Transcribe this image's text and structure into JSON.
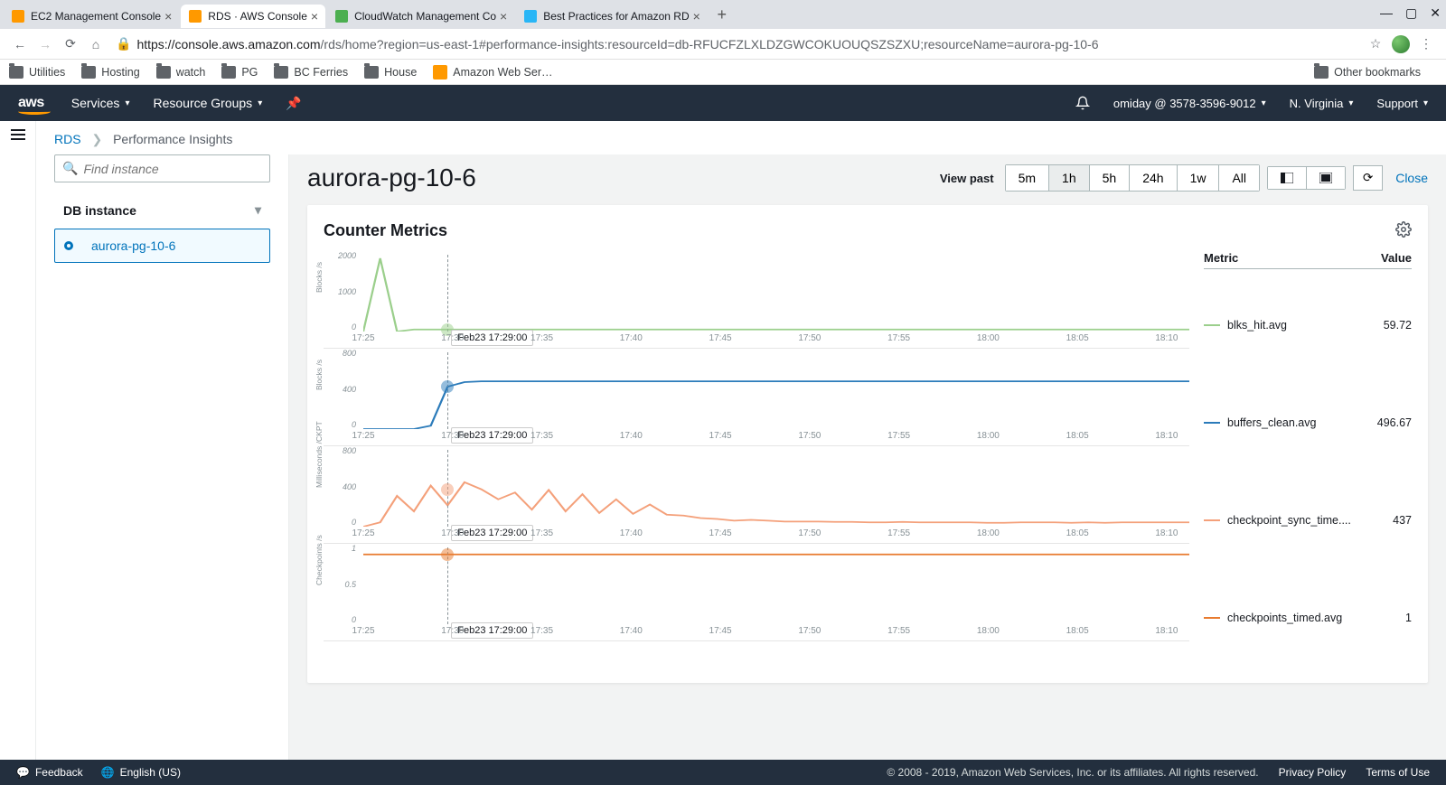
{
  "browser": {
    "tabs": [
      {
        "title": "EC2 Management Console",
        "color": "#ff9900"
      },
      {
        "title": "RDS · AWS Console",
        "color": "#ff9900"
      },
      {
        "title": "CloudWatch Management Co",
        "color": "#4caf50"
      },
      {
        "title": "Best Practices for Amazon RD",
        "color": "#29b6f6"
      }
    ],
    "url_domain": "https://console.aws.amazon.com",
    "url_path": "/rds/home?region=us-east-1#performance-insights:resourceId=db-RFUCFZLXLDZGWCOKUOUQSZSZXU;resourceName=aurora-pg-10-6"
  },
  "bookmarks": {
    "items": [
      "Utilities",
      "Hosting",
      "watch",
      "PG",
      "BC Ferries",
      "House"
    ],
    "aws_label": "Amazon Web Ser…",
    "other": "Other bookmarks"
  },
  "header": {
    "logo": "aws",
    "services": "Services",
    "resource_groups": "Resource Groups",
    "account": "omiday @ 3578-3596-9012",
    "region": "N. Virginia",
    "support": "Support"
  },
  "breadcrumb": {
    "root": "RDS",
    "current": "Performance Insights"
  },
  "sidebar": {
    "search_placeholder": "Find instance",
    "db_header": "DB instance",
    "instance": "aurora-pg-10-6"
  },
  "page": {
    "title": "aurora-pg-10-6",
    "view_past": "View past",
    "ranges": [
      "5m",
      "1h",
      "5h",
      "24h",
      "1w",
      "All"
    ],
    "active_range": "1h",
    "close": "Close"
  },
  "card": {
    "title": "Counter Metrics",
    "metric_h": "Metric",
    "value_h": "Value"
  },
  "cursor_label": "Feb23 17:29:00",
  "xticks": [
    "17:25",
    "17:30",
    "17:35",
    "17:40",
    "17:45",
    "17:50",
    "17:55",
    "18:00",
    "18:05",
    "18:10"
  ],
  "legend": [
    {
      "name": "blks_hit.avg",
      "value": "59.72",
      "color": "#9bcf8c"
    },
    {
      "name": "buffers_clean.avg",
      "value": "496.67",
      "color": "#2b7bba"
    },
    {
      "name": "checkpoint_sync_time....",
      "value": "437",
      "color": "#f4a07a"
    },
    {
      "name": "checkpoints_timed.avg",
      "value": "1",
      "color": "#e87b2f"
    }
  ],
  "chart_data": [
    {
      "type": "line",
      "name": "blks_hit.avg",
      "ylabel": "Blocks /s",
      "yticks": [
        "2000",
        "1000",
        "0"
      ],
      "ylim": [
        0,
        2200
      ],
      "color": "#9bcf8c",
      "cursor_y": 60,
      "x": [
        0,
        1,
        2,
        3,
        4,
        5,
        6,
        7,
        8,
        9,
        10,
        11,
        12,
        13,
        14,
        15,
        16,
        17,
        18,
        19,
        20,
        21,
        22,
        23,
        24,
        25,
        26,
        27,
        28,
        29,
        30,
        31,
        32,
        33,
        34,
        35,
        36,
        37,
        38,
        39,
        40,
        41,
        42,
        43,
        44,
        45,
        46,
        47,
        48,
        49
      ],
      "y": [
        0,
        2100,
        0,
        60,
        60,
        60,
        60,
        60,
        60,
        60,
        60,
        60,
        60,
        60,
        60,
        60,
        60,
        60,
        60,
        60,
        60,
        60,
        60,
        60,
        60,
        60,
        60,
        60,
        60,
        60,
        60,
        60,
        60,
        60,
        60,
        60,
        60,
        60,
        60,
        60,
        60,
        60,
        60,
        60,
        60,
        60,
        60,
        60,
        60,
        60
      ]
    },
    {
      "type": "line",
      "name": "buffers_clean.avg",
      "ylabel": "Blocks /s",
      "yticks": [
        "800",
        "400",
        "0"
      ],
      "ylim": [
        0,
        900
      ],
      "color": "#2b7bba",
      "cursor_y": 497,
      "x": [
        0,
        1,
        2,
        3,
        4,
        5,
        6,
        7,
        8,
        9,
        10,
        11,
        12,
        13,
        14,
        15,
        16,
        17,
        18,
        19,
        20,
        21,
        22,
        23,
        24,
        25,
        26,
        27,
        28,
        29,
        30,
        31,
        32,
        33,
        34,
        35,
        36,
        37,
        38,
        39,
        40,
        41,
        42,
        43,
        44,
        45,
        46,
        47,
        48,
        49
      ],
      "y": [
        0,
        0,
        0,
        0,
        40,
        497,
        550,
        560,
        560,
        560,
        560,
        560,
        560,
        560,
        560,
        560,
        560,
        560,
        560,
        560,
        560,
        560,
        560,
        560,
        560,
        560,
        560,
        560,
        560,
        560,
        560,
        560,
        560,
        560,
        560,
        560,
        560,
        560,
        560,
        560,
        560,
        560,
        560,
        560,
        560,
        560,
        560,
        560,
        560,
        560
      ]
    },
    {
      "type": "line",
      "name": "checkpoint_sync_time",
      "ylabel": "Milliseconds /CKPT",
      "yticks": [
        "800",
        "400",
        "0"
      ],
      "ylim": [
        0,
        900
      ],
      "color": "#f4a07a",
      "cursor_y": 437,
      "x": [
        0,
        1,
        2,
        3,
        4,
        5,
        6,
        7,
        8,
        9,
        10,
        11,
        12,
        13,
        14,
        15,
        16,
        17,
        18,
        19,
        20,
        21,
        22,
        23,
        24,
        25,
        26,
        27,
        28,
        29,
        30,
        31,
        32,
        33,
        34,
        35,
        36,
        37,
        38,
        39,
        40,
        41,
        42,
        43,
        44,
        45,
        46,
        47,
        48,
        49
      ],
      "y": [
        0,
        50,
        360,
        180,
        480,
        250,
        520,
        437,
        320,
        400,
        200,
        430,
        180,
        380,
        160,
        320,
        150,
        260,
        140,
        130,
        100,
        90,
        70,
        80,
        70,
        60,
        60,
        60,
        55,
        55,
        50,
        50,
        55,
        50,
        50,
        50,
        50,
        45,
        45,
        50,
        50,
        50,
        45,
        50,
        45,
        50,
        50,
        50,
        50,
        50
      ]
    },
    {
      "type": "line",
      "name": "checkpoints_timed.avg",
      "ylabel": "Checkpoints /s",
      "yticks": [
        "1",
        "0.5",
        "0"
      ],
      "ylim": [
        0,
        1.1
      ],
      "color": "#e87b2f",
      "cursor_y": 1,
      "x": [
        0,
        1,
        2,
        3,
        4,
        5,
        6,
        7,
        8,
        9,
        10,
        11,
        12,
        13,
        14,
        15,
        16,
        17,
        18,
        19,
        20,
        21,
        22,
        23,
        24,
        25,
        26,
        27,
        28,
        29,
        30,
        31,
        32,
        33,
        34,
        35,
        36,
        37,
        38,
        39,
        40,
        41,
        42,
        43,
        44,
        45,
        46,
        47,
        48,
        49
      ],
      "y": [
        1,
        1,
        1,
        1,
        1,
        1,
        1,
        1,
        1,
        1,
        1,
        1,
        1,
        1,
        1,
        1,
        1,
        1,
        1,
        1,
        1,
        1,
        1,
        1,
        1,
        1,
        1,
        1,
        1,
        1,
        1,
        1,
        1,
        1,
        1,
        1,
        1,
        1,
        1,
        1,
        1,
        1,
        1,
        1,
        1,
        1,
        1,
        1,
        1,
        1
      ]
    }
  ],
  "footer": {
    "feedback": "Feedback",
    "language": "English (US)",
    "copyright": "© 2008 - 2019, Amazon Web Services, Inc. or its affiliates. All rights reserved.",
    "privacy": "Privacy Policy",
    "terms": "Terms of Use"
  }
}
